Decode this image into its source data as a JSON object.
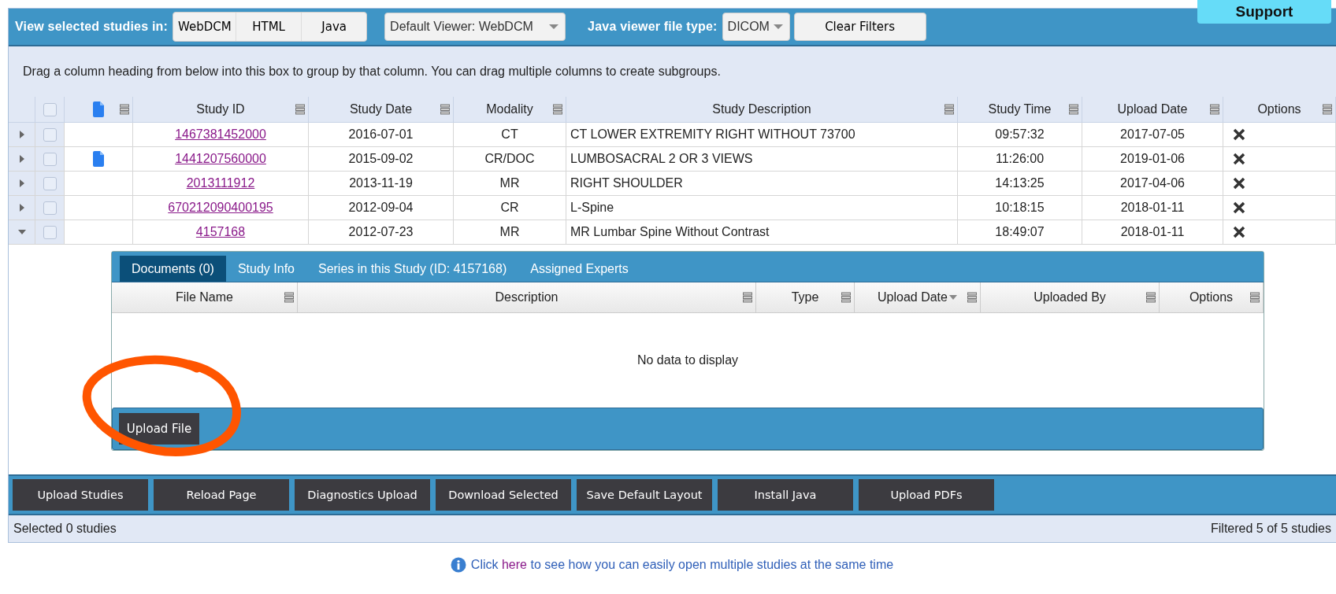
{
  "support_button": "Support",
  "toolbar": {
    "label": "View selected studies in:",
    "viewer_buttons": [
      "WebDCM",
      "HTML",
      "Java"
    ],
    "default_viewer": {
      "value": "Default Viewer: WebDCM"
    },
    "file_type_label": "Java viewer file type:",
    "file_type": {
      "value": "DICOM"
    },
    "clear_button": "Clear Filters"
  },
  "group_hint": "Drag a column heading from below into this box to group by that column. You can drag multiple columns to create subgroups.",
  "table": {
    "select_all": {
      "checked": false
    },
    "columns": [
      "Study ID",
      "Study Date",
      "Modality",
      "Study Description",
      "Study Time",
      "Upload Date",
      "Options"
    ],
    "rows": [
      {
        "expanded": false,
        "checked": false,
        "has_document": false,
        "study_id": "1467381452000",
        "study_date": "2016-07-01",
        "modality": "CT",
        "description": "CT LOWER EXTREMITY RIGHT WITHOUT 73700",
        "study_time": "09:57:32",
        "upload_date": "2017-07-05"
      },
      {
        "expanded": false,
        "checked": false,
        "has_document": true,
        "study_id": "1441207560000",
        "study_date": "2015-09-02",
        "modality": "CR/DOC",
        "description": "LUMBOSACRAL 2 OR 3 VIEWS",
        "study_time": "11:26:00",
        "upload_date": "2019-01-06"
      },
      {
        "expanded": false,
        "checked": false,
        "has_document": false,
        "study_id": "2013111912",
        "study_date": "2013-11-19",
        "modality": "MR",
        "description": "RIGHT SHOULDER",
        "study_time": "14:13:25",
        "upload_date": "2017-04-06"
      },
      {
        "expanded": false,
        "checked": false,
        "has_document": false,
        "study_id": "670212090400195",
        "study_date": "2012-09-04",
        "modality": "CR",
        "description": "L-Spine",
        "study_time": "10:18:15",
        "upload_date": "2018-01-11"
      },
      {
        "expanded": true,
        "checked": false,
        "has_document": false,
        "study_id": "4157168",
        "study_date": "2012-07-23",
        "modality": "MR",
        "description": "MR Lumbar Spine Without Contrast",
        "study_time": "18:49:07",
        "upload_date": "2018-01-11"
      }
    ]
  },
  "detail": {
    "tabs": [
      {
        "label": "Documents (0)",
        "selected": true
      },
      {
        "label": "Study Info",
        "selected": false
      },
      {
        "label": "Series in this Study (ID: 4157168)",
        "selected": false
      },
      {
        "label": "Assigned Experts",
        "selected": false
      }
    ],
    "columns": [
      {
        "label": "File Name",
        "sorted": false
      },
      {
        "label": "Description",
        "sorted": false
      },
      {
        "label": "Type",
        "sorted": false
      },
      {
        "label": "Upload Date",
        "sorted": true
      },
      {
        "label": "Uploaded By",
        "sorted": false
      },
      {
        "label": "Options",
        "sorted": false
      }
    ],
    "empty_message": "No data to display",
    "upload_button": "Upload File"
  },
  "actions": [
    "Upload Studies",
    "Reload Page",
    "Diagnostics Upload",
    "Download Selected",
    "Save Default Layout",
    "Install Java",
    "Upload PDFs"
  ],
  "status": {
    "selected": "Selected 0 studies",
    "filtered": "Filtered 5 of 5 studies"
  },
  "help": {
    "before": "Click ",
    "link": "here",
    "after": " to see how you can easily open multiple studies at the same time"
  },
  "annotation": {
    "kind": "circle"
  }
}
